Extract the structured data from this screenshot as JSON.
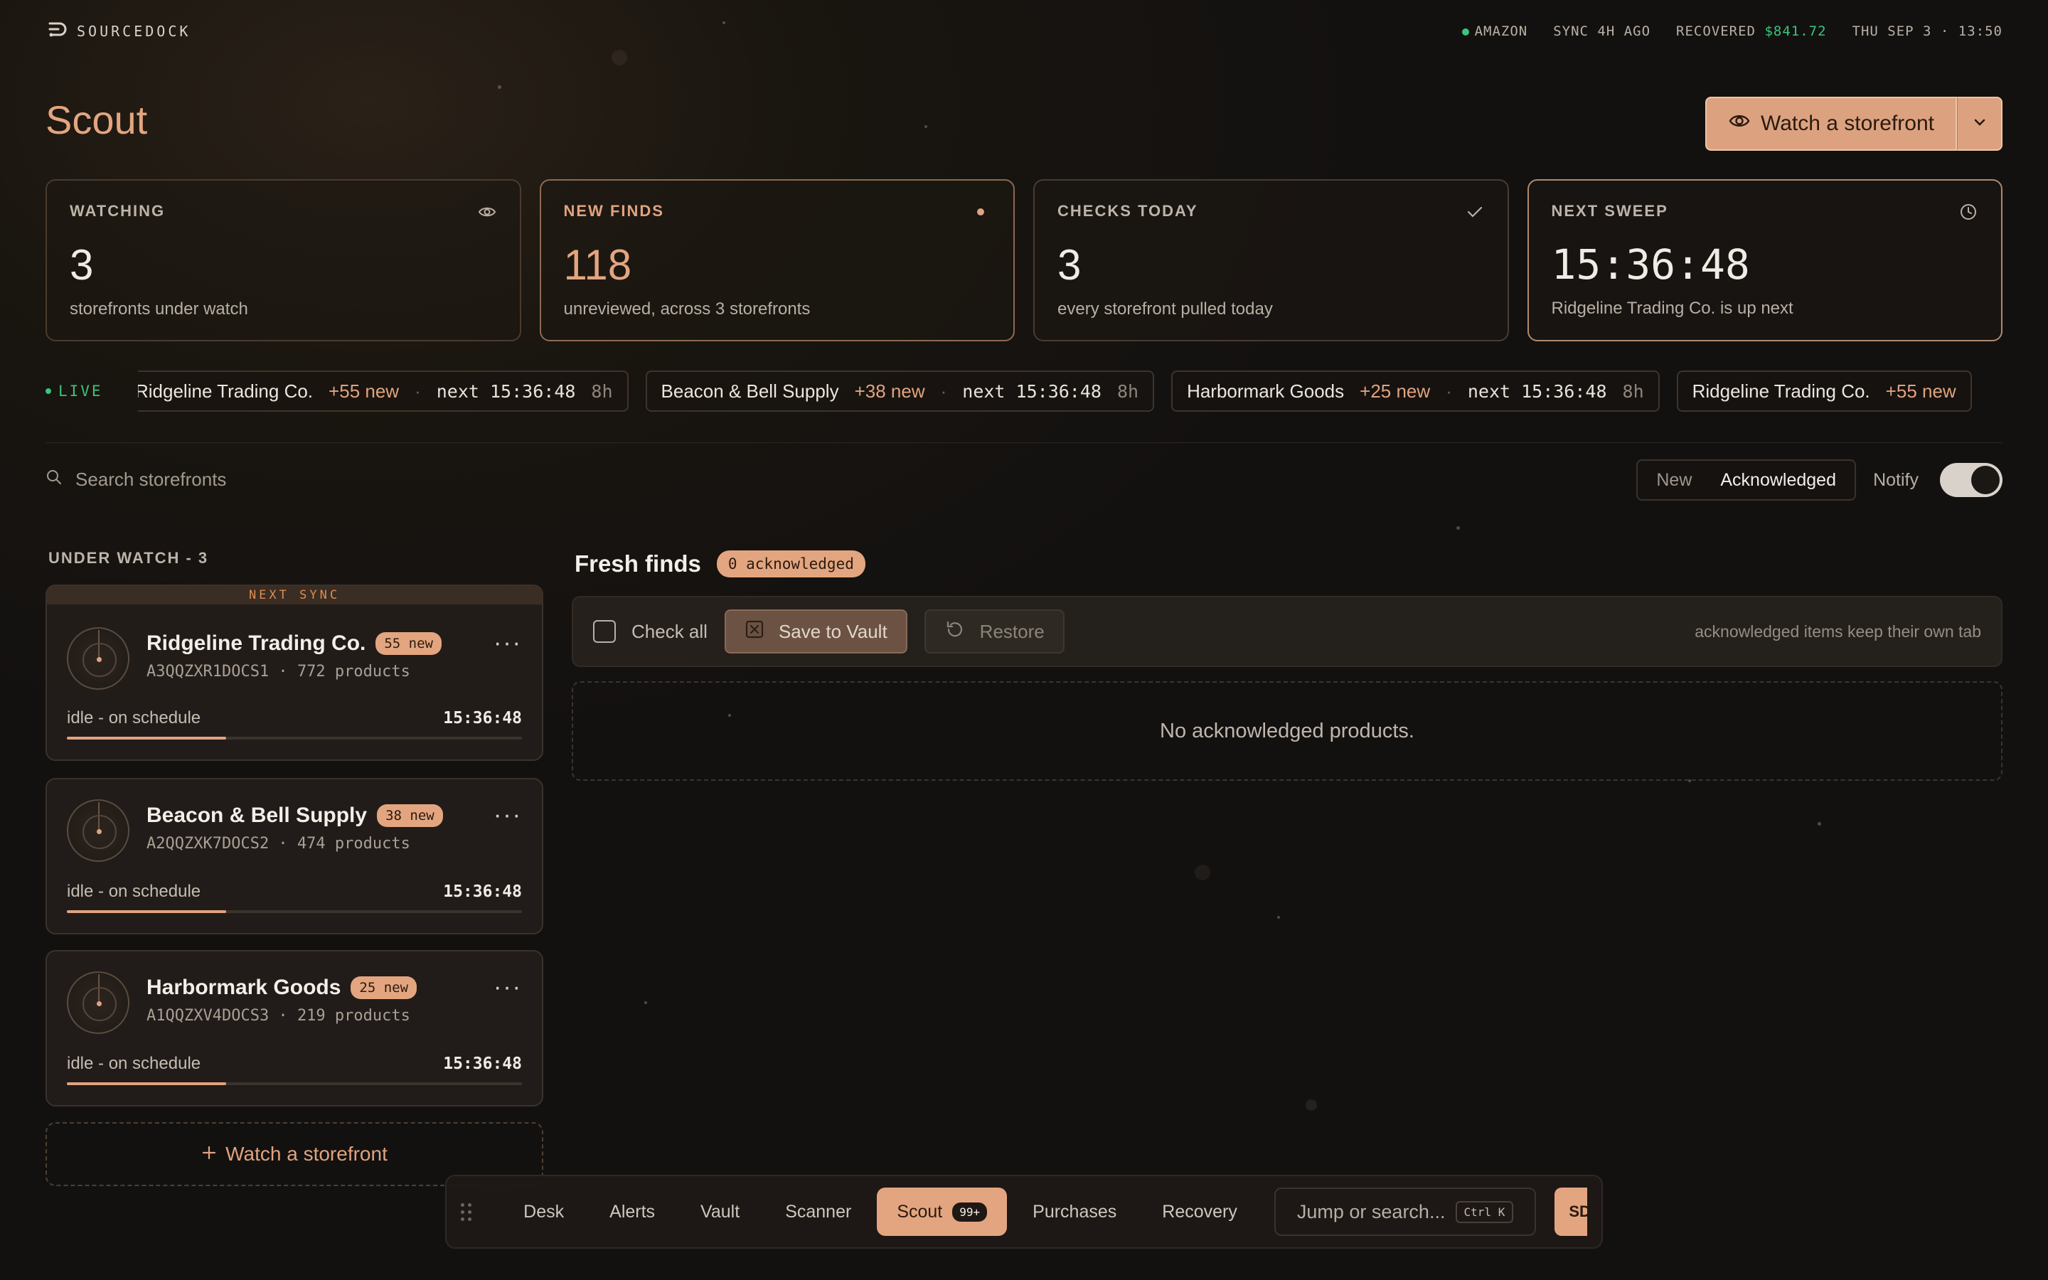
{
  "brand": {
    "name": "SOURCEDOCK",
    "logo_icon": "sourcedock-logo"
  },
  "status": {
    "marketplace": "AMAZON",
    "sync": "SYNC 4H AGO",
    "recovered_label": "RECOVERED",
    "recovered_value": "$841.72",
    "datetime": "THU SEP 3 · 13:50",
    "colors": {
      "online": "#39c47b",
      "accent": "#e0a37f"
    }
  },
  "header": {
    "title": "Scout",
    "watch_button": "Watch a storefront"
  },
  "stats": [
    {
      "label": "WATCHING",
      "value": "3",
      "sub": "storefronts under watch",
      "icon": "eye-icon"
    },
    {
      "label": "NEW FINDS",
      "value": "118",
      "sub": "unreviewed, across 3 storefronts",
      "icon": "dot-icon"
    },
    {
      "label": "CHECKS TODAY",
      "value": "3",
      "sub": "every storefront pulled today",
      "icon": "check-icon"
    },
    {
      "label": "NEXT SWEEP",
      "value": "15:36:48",
      "sub": "Ridgeline Trading Co. is up next",
      "icon": "clock-icon"
    }
  ],
  "ticker": {
    "live_label": "LIVE",
    "items": [
      {
        "name": "Ridgeline Trading Co.",
        "new": "+55 new",
        "next": "next 15:36:48",
        "age": "8h"
      },
      {
        "name": "Beacon & Bell Supply",
        "new": "+38 new",
        "next": "next 15:36:48",
        "age": "8h"
      },
      {
        "name": "Harbormark Goods",
        "new": "+25 new",
        "next": "next 15:36:48",
        "age": "8h"
      },
      {
        "name": "Ridgeline Trading Co.",
        "new": "+55 new",
        "next": "",
        "age": ""
      }
    ]
  },
  "search": {
    "placeholder": "Search storefronts"
  },
  "filter": {
    "options": [
      "New",
      "Acknowledged"
    ],
    "selected": "Acknowledged"
  },
  "notify": {
    "label": "Notify",
    "on": true
  },
  "under_watch": {
    "label": "UNDER WATCH - 3",
    "banner": "NEXT SYNC",
    "stores": [
      {
        "name": "Ridgeline Trading Co.",
        "badge": "55 new",
        "id": "A3QQZXR1DOCS1",
        "products": "772 products",
        "status": "idle - on schedule",
        "next": "15:36:48",
        "progress": 0.35
      },
      {
        "name": "Beacon & Bell Supply",
        "badge": "38 new",
        "id": "A2QQZXK7DOCS2",
        "products": "474 products",
        "status": "idle - on schedule",
        "next": "15:36:48",
        "progress": 0.35
      },
      {
        "name": "Harbormark Goods",
        "badge": "25 new",
        "id": "A1QQZXV4DOCS3",
        "products": "219 products",
        "status": "idle - on schedule",
        "next": "15:36:48",
        "progress": 0.35
      }
    ],
    "add_label": "Watch a storefront"
  },
  "fresh": {
    "title": "Fresh finds",
    "badge": "0 acknowledged",
    "check_all": "Check all",
    "save_vault": "Save to Vault",
    "restore": "Restore",
    "note": "acknowledged items keep their own tab",
    "empty": "No acknowledged products."
  },
  "dock": {
    "items": [
      "Desk",
      "Alerts",
      "Vault",
      "Scanner",
      "Scout",
      "Purchases",
      "Recovery"
    ],
    "active": "Scout",
    "scout_count": "99+",
    "jump_placeholder": "Jump or search...",
    "shortcut": "Ctrl K",
    "avatar": "SD"
  }
}
